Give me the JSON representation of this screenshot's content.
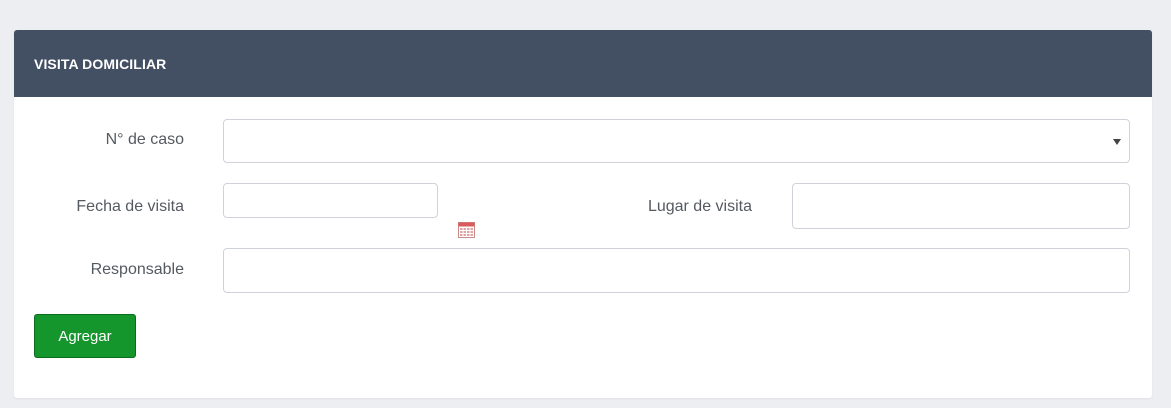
{
  "panel": {
    "title": "VISITA DOMICILIAR"
  },
  "form": {
    "case_number": {
      "label": "N° de caso",
      "value": ""
    },
    "visit_date": {
      "label": "Fecha de visita",
      "value": ""
    },
    "visit_place": {
      "label": "Lugar de visita",
      "value": ""
    },
    "responsible": {
      "label": "Responsable",
      "value": ""
    }
  },
  "actions": {
    "add_label": "Agregar"
  },
  "icons": {
    "calendar": "calendar-icon",
    "select_arrow": "chevron-down-icon"
  },
  "colors": {
    "header_bg": "#434f63",
    "button_bg": "#15962d",
    "page_bg": "#eceef1"
  }
}
